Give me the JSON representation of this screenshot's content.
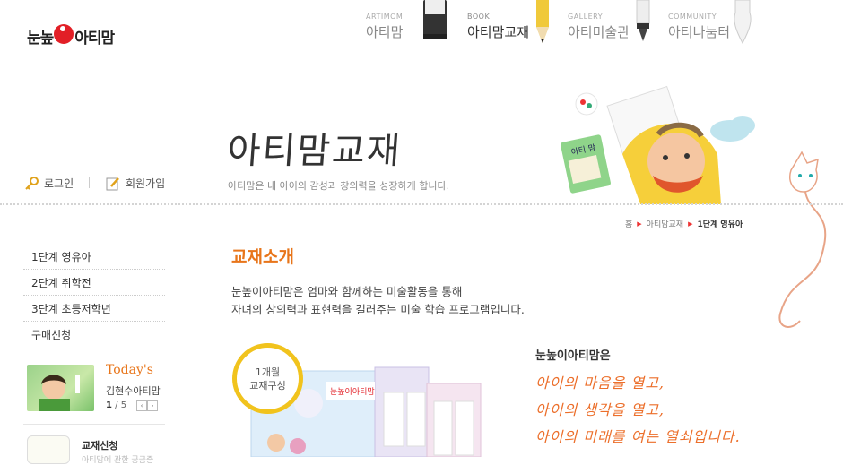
{
  "header": {
    "logo": {
      "part1": "눈높",
      "part2": "아티맘"
    },
    "nav": [
      {
        "en": "ARTIMOM",
        "ko": "아티맘",
        "active": false
      },
      {
        "en": "BOOK",
        "ko": "아티맘교재",
        "active": true
      },
      {
        "en": "GALLERY",
        "ko": "아티미술관",
        "active": false
      },
      {
        "en": "COMMUNITY",
        "ko": "아티나눔터",
        "active": false
      }
    ]
  },
  "hero": {
    "title": "아티맘교재",
    "subtitle": "아티맘은 내 아이의 감성과 창의력을 성장하게 합니다.",
    "book_label": "아티 맘"
  },
  "util": {
    "login": "로그인",
    "join": "회원가입"
  },
  "breadcrumb": {
    "home": "홈",
    "level1": "아티맘교재",
    "current": "1단계 영유아"
  },
  "sidebar": {
    "menu": [
      "1단계 영유아",
      "2단계 취학전",
      "3단계 초등저학년",
      "구매신청"
    ],
    "today": {
      "title": "Today's",
      "name": "김현수아티맘",
      "current": "1",
      "total": "/ 5"
    },
    "order": {
      "label": "교재신청",
      "sub": "아티맘에 관한 궁금증"
    }
  },
  "content": {
    "title": "교재소개",
    "intro": [
      "눈높이아티맘은 엄마와 함께하는 미술활동을 통해",
      "자녀의 창의력과 표현력을 길러주는 미술 학습 프로그램입니다."
    ],
    "badge": [
      "1개월",
      "교재구성"
    ],
    "product_label": "눈높이아티맘",
    "right_title": "눈높이아티맘은",
    "right_lines": [
      "아이의 마음을 열고,",
      "아이의 생각을 열고,",
      "아이의 미래를 여는 열쇠입니다."
    ]
  },
  "colors": {
    "accent": "#e8751a",
    "brand_red": "#e21f26",
    "badge_ring": "#f1c31d",
    "handwriting": "#ec6f2b"
  }
}
